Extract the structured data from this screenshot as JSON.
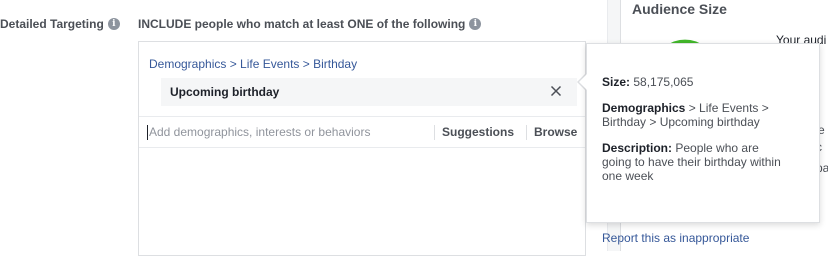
{
  "detailed_targeting": {
    "label": "Detailed Targeting",
    "info_icon": "info-icon"
  },
  "include": {
    "text": "INCLUDE people who match at least ONE of the following",
    "info_icon": "info-icon"
  },
  "selection": {
    "breadcrumb": "Demographics > Life Events > Birthday",
    "chip_label": "Upcoming birthday",
    "remove_icon": "close-icon"
  },
  "search": {
    "placeholder": "Add demographics, interests or behaviors",
    "value": "",
    "suggestions_label": "Suggestions",
    "browse_label": "Browse"
  },
  "tooltip": {
    "size_label": "Size:",
    "size_value": "58,175,065",
    "demographics_label": "Demographics",
    "demographics_value": "> Life Events > Birthday > Upcoming birthday",
    "description_label": "Description:",
    "description_value": "People who are going to have their birthday within one week",
    "report_link": "Report this as inappropriate"
  },
  "audience": {
    "title": "Audience Size",
    "desc_line1": "Your audi",
    "desc_line2": "n",
    "frag_e": "e",
    "frag_c": "c",
    "frag_pa": "pa"
  },
  "colors": {
    "link": "#365899",
    "gauge_green": "#42b72a",
    "chip_bg": "#f5f6f7",
    "border": "#dddfe2"
  }
}
